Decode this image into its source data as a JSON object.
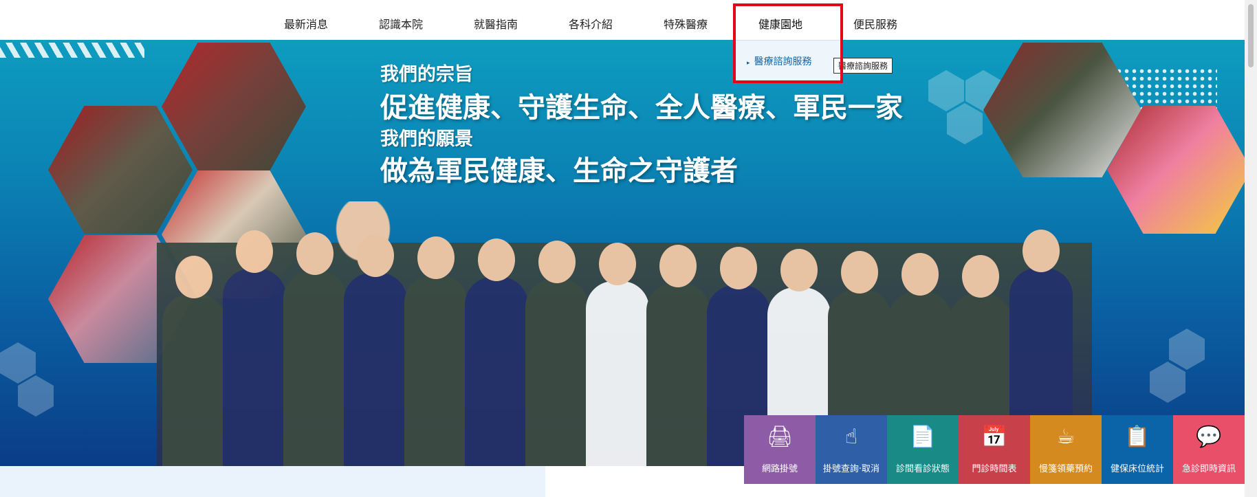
{
  "nav": {
    "items": [
      {
        "label": "最新消息"
      },
      {
        "label": "認識本院"
      },
      {
        "label": "就醫指南"
      },
      {
        "label": "各科介紹"
      },
      {
        "label": "特殊醫療"
      },
      {
        "label": "健康園地"
      },
      {
        "label": "便民服務"
      }
    ],
    "active_index": 5,
    "highlight_color": "#e2061b"
  },
  "dropdown": {
    "items": [
      {
        "label": "醫療諮詢服務",
        "icon": "triangle-bullet-icon"
      }
    ]
  },
  "tooltip": {
    "text": "醫療諮詢服務"
  },
  "banner": {
    "mission_label": "我們的宗旨",
    "mission_text": "促進健康、守護生命、全人醫療、軍民一家",
    "vision_label": "我們的願景",
    "vision_text": "做為軍民健康、生命之守護者"
  },
  "tiles": [
    {
      "label": "網路掛號",
      "icon": "online-registration-icon",
      "color": "#8e5ba7"
    },
    {
      "label": "掛號查詢‧取消",
      "icon": "tap-query-icon",
      "color": "#2f5fa6"
    },
    {
      "label": "診間看診狀態",
      "icon": "clinic-status-icon",
      "color": "#198a86"
    },
    {
      "label": "門診時間表",
      "icon": "calendar-clock-icon",
      "color": "#c8404a"
    },
    {
      "label": "慢箋領藥預約",
      "icon": "mortar-pestle-icon",
      "color": "#d48a1f"
    },
    {
      "label": "健保床位統計",
      "icon": "bed-stats-icon",
      "color": "#0b63a8"
    },
    {
      "label": "急診即時資訊",
      "icon": "emergency-chat-icon",
      "color": "#ea4f6a"
    }
  ]
}
